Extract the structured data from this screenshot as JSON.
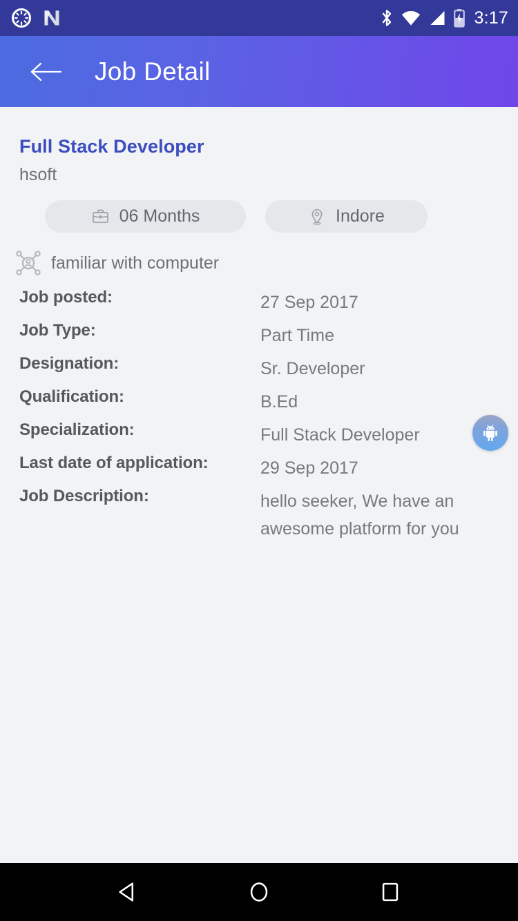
{
  "status_bar": {
    "background": "#323999",
    "time": "3:17",
    "icons": [
      "clock-sync-icon",
      "android-nougat-icon",
      "bluetooth-icon",
      "wifi-icon",
      "cellular-signal-icon",
      "battery-charging-icon"
    ]
  },
  "app_bar": {
    "title": "Job Detail",
    "back_icon": "arrow-left-icon",
    "gradient_start": "#4C6BE0",
    "gradient_end": "#7046E9"
  },
  "job": {
    "title": "Full Stack Developer",
    "title_color": "#3B4DBF",
    "company": "hsoft",
    "chips": [
      {
        "icon": "briefcase-icon",
        "label": "06 Months"
      },
      {
        "icon": "location-pin-icon",
        "label": "Indore"
      }
    ],
    "skill": {
      "icon": "skills-network-icon",
      "label": "familiar with computer"
    },
    "details": [
      {
        "label": "Job posted:",
        "value": "27 Sep 2017"
      },
      {
        "label": "Job Type:",
        "value": "Part Time"
      },
      {
        "label": "Designation:",
        "value": "Sr. Developer"
      },
      {
        "label": "Qualification:",
        "value": "B.Ed"
      },
      {
        "label": "Specialization:",
        "value": "Full Stack Developer"
      },
      {
        "label": "Last date of application:",
        "value": "29 Sep 2017"
      },
      {
        "label": "Job Description:",
        "value": "hello seeker, We have an\nawesome platform for you"
      }
    ]
  },
  "floating_bubble": {
    "icon": "android-robot-icon"
  },
  "nav_bar": {
    "background": "#000000",
    "buttons": [
      {
        "name": "back",
        "icon": "nav-back-triangle-icon"
      },
      {
        "name": "home",
        "icon": "nav-home-circle-icon"
      },
      {
        "name": "recents",
        "icon": "nav-recents-square-icon"
      }
    ]
  }
}
